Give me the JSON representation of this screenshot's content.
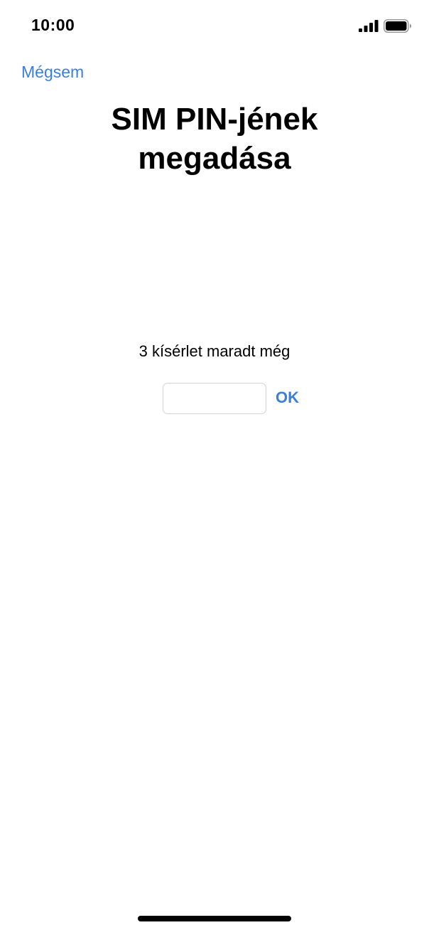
{
  "status_bar": {
    "time": "10:00",
    "signal_icon": "cellular-signal-icon",
    "battery_icon": "battery-icon"
  },
  "nav": {
    "cancel_label": "Mégsem"
  },
  "header": {
    "title_line1": "SIM PIN-jének",
    "title_line2": "megadása"
  },
  "pin_entry": {
    "attempts_text": "3 kísérlet maradt még",
    "value": "",
    "ok_label": "OK"
  },
  "colors": {
    "accent": "#3a7fd9",
    "input_border": "#d4d4d8"
  }
}
